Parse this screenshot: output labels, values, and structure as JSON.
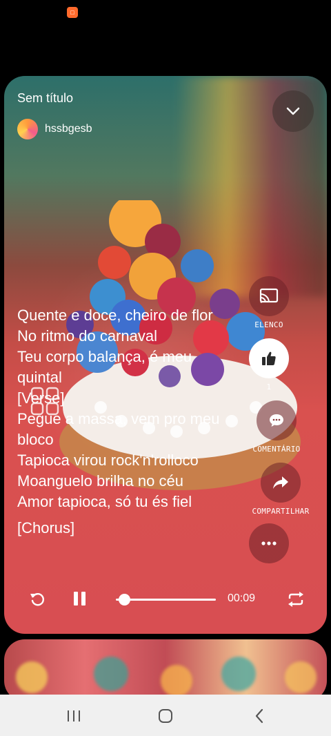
{
  "status_bar": {
    "app_icon": "app-notification-icon"
  },
  "player": {
    "title": "Sem título",
    "username": "hssbgesb",
    "time": "00:09",
    "progress": 0.08
  },
  "lyrics": {
    "lines": [
      {
        "text": "Quente e doce, cheiro de flor",
        "wrap": true
      },
      {
        "text": "No ritmo do carnaval"
      },
      {
        "text": "Teu corpo balança, é meu quintal",
        "wrap": true
      },
      {
        "text": "[Verse]"
      },
      {
        "text": "Pegue a massa, vem pro meu bloco",
        "wrap": true
      },
      {
        "text": "Tapioca virou rock'n'rolloco"
      },
      {
        "text": "Moanguelo brilha no céu"
      },
      {
        "text": "Amor tapioca, só tu és fiel"
      },
      {
        "text": "[Chorus]",
        "gap": true
      }
    ]
  },
  "actions": {
    "elenco_label": "ELENCO",
    "like_count": "1",
    "comment_label": "COMENTÁRIO",
    "share_label": "COMPARTILHAR"
  },
  "icons": [
    "chevron-down-icon",
    "cast-icon",
    "thumbs-up-icon",
    "comment-icon",
    "share-icon",
    "more-icon",
    "pause-icon",
    "replay-icon",
    "repeat-icon",
    "grid-icon"
  ],
  "colors": {
    "card_base": "#d9514f",
    "navbar": "#f0f0f0",
    "status_icon": "#ff6a2c"
  }
}
